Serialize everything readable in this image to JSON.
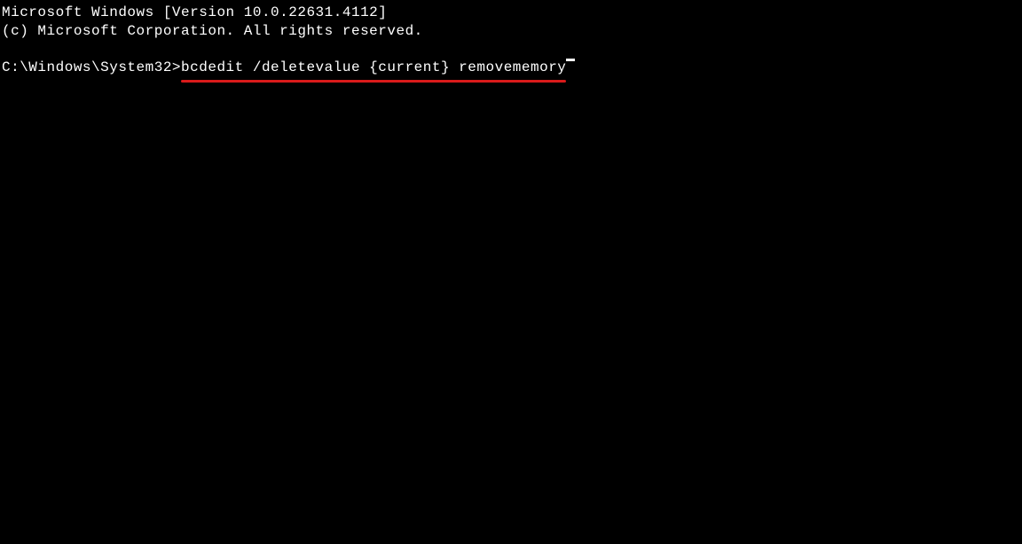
{
  "header": {
    "line1": "Microsoft Windows [Version 10.0.22631.4112]",
    "line2": "(c) Microsoft Corporation. All rights reserved."
  },
  "prompt": {
    "path": "C:\\Windows\\System32>",
    "command": "bcdedit /deletevalue {current} removememory"
  }
}
